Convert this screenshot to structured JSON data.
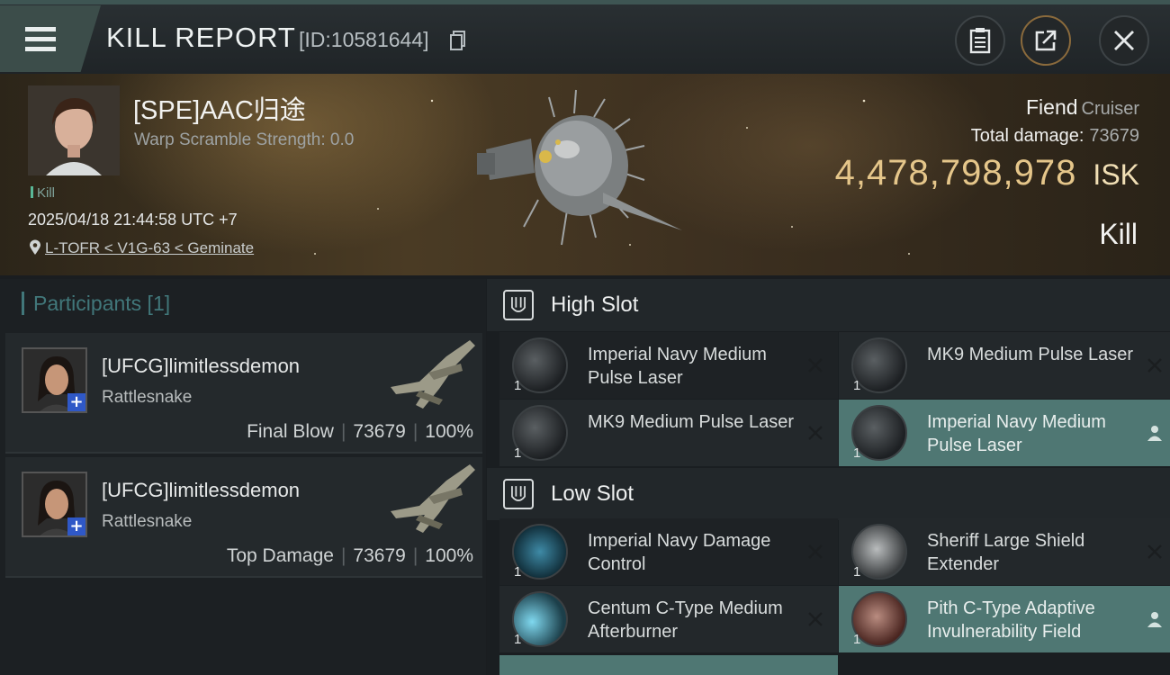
{
  "header": {
    "title": "KILL REPORT",
    "report_id": "[ID:10581644]"
  },
  "victim": {
    "name": "[SPE]AAC归途",
    "warp_scramble": "Warp Scramble Strength: 0.0",
    "kill_tag": "Kill",
    "datetime": "2025/04/18 21:44:58 UTC +7",
    "location": "L-TOFR < V1G-63 < Geminate"
  },
  "ship": {
    "name": "Fiend",
    "class": "Cruiser",
    "total_damage_label": "Total damage:",
    "total_damage": "73679",
    "isk_value": "4,478,798,978",
    "isk_unit": "ISK",
    "result": "Kill"
  },
  "participants": {
    "header": "Participants [1]",
    "cards": [
      {
        "name": "[UFCG]limitlessdemon",
        "ship": "Rattlesnake",
        "role": "Final Blow",
        "damage": "73679",
        "percent": "100%"
      },
      {
        "name": "[UFCG]limitlessdemon",
        "ship": "Rattlesnake",
        "role": "Top Damage",
        "damage": "73679",
        "percent": "100%"
      }
    ]
  },
  "slots": {
    "high_title": "High Slot",
    "low_title": "Low Slot",
    "high": [
      {
        "name": "Imperial Navy Medium Pulse Laser",
        "qty": "1",
        "state": "destroyed"
      },
      {
        "name": "MK9 Medium Pulse Laser",
        "qty": "1",
        "state": "destroyed"
      },
      {
        "name": "MK9 Medium Pulse Laser",
        "qty": "1",
        "state": "destroyed"
      },
      {
        "name": "Imperial Navy Medium Pulse Laser",
        "qty": "1",
        "state": "dropped"
      }
    ],
    "low": [
      {
        "name": "Imperial Navy Damage Control",
        "qty": "1",
        "state": "destroyed"
      },
      {
        "name": "Sheriff Large Shield Extender",
        "qty": "1",
        "state": "destroyed"
      },
      {
        "name": "Centum C-Type Medium Afterburner",
        "qty": "1",
        "state": "destroyed"
      },
      {
        "name": "Pith C-Type Adaptive Invulnerability Field",
        "qty": "1",
        "state": "dropped"
      }
    ]
  },
  "colors": {
    "accent_teal": "#4f7773",
    "isk_gold": "#e5c68a",
    "participants_teal": "#41777a"
  },
  "icons": [
    "menu-icon",
    "copy-icon",
    "clipboard-icon",
    "share-icon",
    "close-icon",
    "location-pin-icon",
    "slot-icon",
    "destroyed-x-icon",
    "dropped-person-icon"
  ]
}
